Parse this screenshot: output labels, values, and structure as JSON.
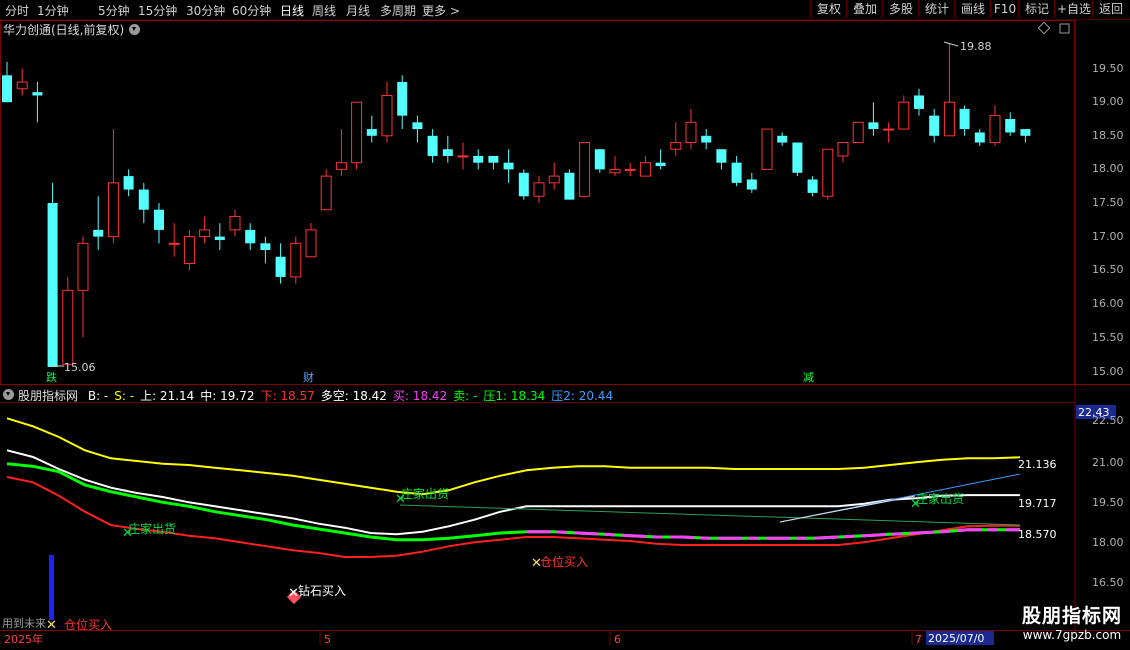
{
  "toolbar": {
    "periods": [
      "分时",
      "1分钟",
      "5分钟",
      "15分钟",
      "30分钟",
      "60分钟",
      "日线",
      "周线",
      "月线",
      "多周期",
      "更多 >"
    ],
    "active_period": "日线",
    "right_buttons": [
      "复权",
      "叠加",
      "多股",
      "统计",
      "画线",
      "F10",
      "标记",
      "+自选",
      "返回"
    ]
  },
  "main_chart": {
    "title": "华力创通(日线,前复权)",
    "high_label": "19.88",
    "low_label": "15.06",
    "events": [
      "跌",
      "财",
      "减"
    ],
    "y_ticks": [
      "19.50",
      "19.00",
      "18.50",
      "18.00",
      "17.50",
      "17.00",
      "16.50",
      "16.00",
      "15.50",
      "15.00"
    ]
  },
  "indicator": {
    "title": "股朋指标网",
    "items": [
      {
        "text": "B: -",
        "color": "#ffffff"
      },
      {
        "text": "S: -",
        "color": "#ffff00"
      },
      {
        "text": "上: 21.14",
        "color": "#ffffff"
      },
      {
        "text": "中: 19.72",
        "color": "#ffffff"
      },
      {
        "text": "下: 18.57",
        "color": "#ff3030"
      },
      {
        "text": "多空: 18.42",
        "color": "#ffffff"
      },
      {
        "text": "买: 18.42",
        "color": "#ff40ff"
      },
      {
        "text": "卖: -",
        "color": "#00ff00"
      },
      {
        "text": "压1: 18.34",
        "color": "#00ff00"
      },
      {
        "text": "压2: 20.44",
        "color": "#3aa0ff"
      }
    ],
    "y_ticks": [
      "22.50",
      "21.00",
      "19.50",
      "18.00",
      "16.50"
    ],
    "current_value": "22.43",
    "end_labels": [
      "21.136",
      "19.717",
      "18.570"
    ],
    "signals": [
      "庄家出货",
      "庄家出货",
      "庄家出货",
      "钻石买入",
      "仓位买入",
      "仓位买入"
    ]
  },
  "x_axis": {
    "labels": [
      "2025年",
      "5",
      "6",
      "7"
    ],
    "current_date": "2025/07/0"
  },
  "footnote": "用到未来",
  "watermark": {
    "title": "股朋指标网",
    "url": "www.7gpzb.com"
  },
  "colors": {
    "up": "#ff3232",
    "down": "#54ffff",
    "upper": "#ffff00",
    "mid": "#ffffff",
    "lower": "#ff2020",
    "long_short": "#00ff00"
  },
  "chart_data": {
    "type": "candlestick",
    "price_range": [
      15.0,
      19.88
    ],
    "candles": [
      {
        "o": 19.4,
        "c": 19.0,
        "h": 19.6,
        "l": 19.0
      },
      {
        "o": 19.2,
        "c": 19.3,
        "h": 19.5,
        "l": 19.1
      },
      {
        "o": 19.15,
        "c": 19.1,
        "h": 19.3,
        "l": 18.7
      },
      {
        "o": 17.5,
        "c": 15.06,
        "h": 17.8,
        "l": 15.06
      },
      {
        "o": 15.1,
        "c": 16.2,
        "h": 16.4,
        "l": 15.05
      },
      {
        "o": 16.2,
        "c": 16.9,
        "h": 17.0,
        "l": 15.5
      },
      {
        "o": 17.1,
        "c": 17.0,
        "h": 17.6,
        "l": 16.8
      },
      {
        "o": 17.0,
        "c": 17.8,
        "h": 18.6,
        "l": 16.9
      },
      {
        "o": 17.9,
        "c": 17.7,
        "h": 18.0,
        "l": 17.6
      },
      {
        "o": 17.7,
        "c": 17.4,
        "h": 17.8,
        "l": 17.2
      },
      {
        "o": 17.4,
        "c": 17.1,
        "h": 17.5,
        "l": 16.9
      },
      {
        "o": 16.9,
        "c": 16.9,
        "h": 17.2,
        "l": 16.7
      },
      {
        "o": 16.6,
        "c": 17.0,
        "h": 17.1,
        "l": 16.5
      },
      {
        "o": 17.0,
        "c": 17.1,
        "h": 17.3,
        "l": 16.9
      },
      {
        "o": 17.0,
        "c": 16.95,
        "h": 17.2,
        "l": 16.8
      },
      {
        "o": 17.1,
        "c": 17.3,
        "h": 17.4,
        "l": 17.0
      },
      {
        "o": 17.1,
        "c": 16.9,
        "h": 17.2,
        "l": 16.8
      },
      {
        "o": 16.9,
        "c": 16.8,
        "h": 17.0,
        "l": 16.6
      },
      {
        "o": 16.7,
        "c": 16.4,
        "h": 16.9,
        "l": 16.3
      },
      {
        "o": 16.4,
        "c": 16.9,
        "h": 17.0,
        "l": 16.3
      },
      {
        "o": 16.7,
        "c": 17.1,
        "h": 17.2,
        "l": 16.7
      },
      {
        "o": 17.4,
        "c": 17.9,
        "h": 18.0,
        "l": 17.4
      },
      {
        "o": 18.0,
        "c": 18.1,
        "h": 18.6,
        "l": 17.9
      },
      {
        "o": 18.1,
        "c": 19.0,
        "h": 19.0,
        "l": 18.0
      },
      {
        "o": 18.6,
        "c": 18.5,
        "h": 18.8,
        "l": 18.4
      },
      {
        "o": 18.5,
        "c": 19.1,
        "h": 19.3,
        "l": 18.4
      },
      {
        "o": 19.3,
        "c": 18.8,
        "h": 19.4,
        "l": 18.6
      },
      {
        "o": 18.7,
        "c": 18.6,
        "h": 18.8,
        "l": 18.4
      },
      {
        "o": 18.5,
        "c": 18.2,
        "h": 18.6,
        "l": 18.1
      },
      {
        "o": 18.3,
        "c": 18.2,
        "h": 18.5,
        "l": 18.1
      },
      {
        "o": 18.2,
        "c": 18.2,
        "h": 18.4,
        "l": 18.0
      },
      {
        "o": 18.2,
        "c": 18.1,
        "h": 18.3,
        "l": 18.0
      },
      {
        "o": 18.2,
        "c": 18.1,
        "h": 18.2,
        "l": 18.0
      },
      {
        "o": 18.1,
        "c": 18.0,
        "h": 18.3,
        "l": 17.8
      },
      {
        "o": 17.95,
        "c": 17.6,
        "h": 18.0,
        "l": 17.55
      },
      {
        "o": 17.6,
        "c": 17.8,
        "h": 17.9,
        "l": 17.5
      },
      {
        "o": 17.8,
        "c": 17.9,
        "h": 18.1,
        "l": 17.7
      },
      {
        "o": 17.95,
        "c": 17.55,
        "h": 18.0,
        "l": 17.55
      },
      {
        "o": 17.6,
        "c": 18.4,
        "h": 18.4,
        "l": 17.6
      },
      {
        "o": 18.3,
        "c": 18.0,
        "h": 18.3,
        "l": 17.95
      },
      {
        "o": 17.95,
        "c": 18.0,
        "h": 18.2,
        "l": 17.9
      },
      {
        "o": 18.0,
        "c": 18.0,
        "h": 18.1,
        "l": 17.9
      },
      {
        "o": 17.9,
        "c": 18.1,
        "h": 18.2,
        "l": 17.9
      },
      {
        "o": 18.1,
        "c": 18.05,
        "h": 18.3,
        "l": 18.0
      },
      {
        "o": 18.3,
        "c": 18.4,
        "h": 18.7,
        "l": 18.2
      },
      {
        "o": 18.4,
        "c": 18.7,
        "h": 18.9,
        "l": 18.3
      },
      {
        "o": 18.5,
        "c": 18.4,
        "h": 18.6,
        "l": 18.3
      },
      {
        "o": 18.3,
        "c": 18.1,
        "h": 18.3,
        "l": 18.0
      },
      {
        "o": 18.1,
        "c": 17.8,
        "h": 18.2,
        "l": 17.75
      },
      {
        "o": 17.85,
        "c": 17.7,
        "h": 17.95,
        "l": 17.65
      },
      {
        "o": 18.0,
        "c": 18.6,
        "h": 18.6,
        "l": 18.0
      },
      {
        "o": 18.5,
        "c": 18.4,
        "h": 18.55,
        "l": 18.35
      },
      {
        "o": 18.4,
        "c": 17.95,
        "h": 18.4,
        "l": 17.9
      },
      {
        "o": 17.85,
        "c": 17.65,
        "h": 17.9,
        "l": 17.6
      },
      {
        "o": 17.6,
        "c": 18.3,
        "h": 18.3,
        "l": 17.55
      },
      {
        "o": 18.2,
        "c": 18.4,
        "h": 18.4,
        "l": 18.1
      },
      {
        "o": 18.4,
        "c": 18.7,
        "h": 18.7,
        "l": 18.4
      },
      {
        "o": 18.7,
        "c": 18.6,
        "h": 19.0,
        "l": 18.5
      },
      {
        "o": 18.6,
        "c": 18.6,
        "h": 18.7,
        "l": 18.4
      },
      {
        "o": 18.6,
        "c": 19.0,
        "h": 19.1,
        "l": 18.6
      },
      {
        "o": 19.1,
        "c": 18.9,
        "h": 19.2,
        "l": 18.8
      },
      {
        "o": 18.8,
        "c": 18.5,
        "h": 18.9,
        "l": 18.4
      },
      {
        "o": 18.5,
        "c": 19.0,
        "h": 19.88,
        "l": 18.5
      },
      {
        "o": 18.9,
        "c": 18.6,
        "h": 18.95,
        "l": 18.5
      },
      {
        "o": 18.55,
        "c": 18.4,
        "h": 18.6,
        "l": 18.35
      },
      {
        "o": 18.4,
        "c": 18.8,
        "h": 18.95,
        "l": 18.35
      },
      {
        "o": 18.75,
        "c": 18.55,
        "h": 18.85,
        "l": 18.5
      },
      {
        "o": 18.6,
        "c": 18.5,
        "h": 18.6,
        "l": 18.4
      }
    ],
    "indicator_lines": {
      "upper": [
        22.6,
        22.3,
        21.9,
        21.4,
        21.1,
        21.0,
        20.9,
        20.85,
        20.75,
        20.65,
        20.55,
        20.45,
        20.3,
        20.15,
        20.0,
        19.85,
        19.75,
        19.9,
        20.2,
        20.45,
        20.65,
        20.75,
        20.8,
        20.8,
        20.75,
        20.75,
        20.75,
        20.75,
        20.7,
        20.7,
        20.7,
        20.7,
        20.7,
        20.75,
        20.85,
        20.95,
        21.05,
        21.1,
        21.1,
        21.14
      ],
      "mid": [
        21.4,
        21.15,
        20.7,
        20.3,
        20.0,
        19.8,
        19.65,
        19.45,
        19.3,
        19.15,
        19.0,
        18.85,
        18.65,
        18.5,
        18.3,
        18.25,
        18.35,
        18.55,
        18.8,
        19.1,
        19.3,
        19.3,
        19.3,
        19.3,
        19.3,
        19.3,
        19.3,
        19.3,
        19.3,
        19.3,
        19.3,
        19.3,
        19.3,
        19.4,
        19.55,
        19.6,
        19.7,
        19.72,
        19.72,
        19.72
      ],
      "lower": [
        20.4,
        20.2,
        19.7,
        19.1,
        18.6,
        18.45,
        18.35,
        18.2,
        18.1,
        17.95,
        17.8,
        17.65,
        17.55,
        17.4,
        17.4,
        17.45,
        17.6,
        17.8,
        17.95,
        18.05,
        18.15,
        18.15,
        18.1,
        18.05,
        18.0,
        17.9,
        17.85,
        17.85,
        17.85,
        17.85,
        17.85,
        17.85,
        17.85,
        17.95,
        18.1,
        18.25,
        18.4,
        18.55,
        18.57,
        18.57
      ],
      "long_short": [
        20.9,
        20.8,
        20.6,
        20.1,
        19.85,
        19.65,
        19.45,
        19.3,
        19.1,
        18.95,
        18.8,
        18.6,
        18.45,
        18.3,
        18.15,
        18.05,
        18.05,
        18.1,
        18.2,
        18.3,
        18.35,
        18.35,
        18.3,
        18.25,
        18.2,
        18.15,
        18.15,
        18.1,
        18.1,
        18.1,
        18.1,
        18.1,
        18.15,
        18.2,
        18.25,
        18.3,
        18.35,
        18.42,
        18.42,
        18.42
      ]
    }
  }
}
